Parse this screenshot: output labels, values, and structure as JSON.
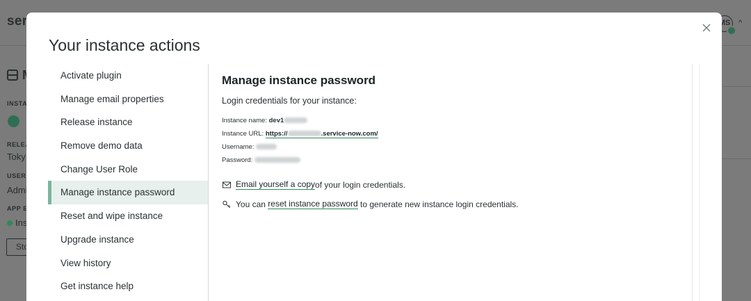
{
  "background": {
    "logo": "serv",
    "avatar_initials": "MS",
    "title_letter": "M",
    "label_instance": "INSTA",
    "label_release": "RELEA",
    "release_value": "Toky",
    "label_user": "USER",
    "user_value": "Admi",
    "label_app": "APP E",
    "status_value": "Ins",
    "button_label": "Sto"
  },
  "modal": {
    "title": "Your instance actions",
    "close_icon": "close-icon",
    "menu": [
      {
        "label": "Activate plugin"
      },
      {
        "label": "Manage email properties"
      },
      {
        "label": "Release instance"
      },
      {
        "label": "Remove demo data"
      },
      {
        "label": "Change User Role"
      },
      {
        "label": "Manage instance password",
        "active": true
      },
      {
        "label": "Reset and wipe instance"
      },
      {
        "label": "Upgrade instance"
      },
      {
        "label": "View history"
      },
      {
        "label": "Get instance help"
      }
    ],
    "detail": {
      "heading": "Manage instance password",
      "subtitle": "Login credentials for your instance:",
      "instance_name_label": "Instance name:",
      "instance_name_value": "dev1",
      "instance_url_label": "Instance URL:",
      "instance_url_prefix": "https://",
      "instance_url_suffix": ".service-now.com/",
      "username_label": "Username:",
      "password_label": "Password:",
      "email_link": "Email yourself a copy",
      "email_rest": "of your login credentials.",
      "reset_prefix": "You can",
      "reset_link": "reset instance password",
      "reset_rest": "to generate new instance login credentials."
    }
  },
  "colors": {
    "accent_green": "#7bb69c",
    "active_bg": "#e7f0ec",
    "overlay": "#7a7b7a"
  }
}
